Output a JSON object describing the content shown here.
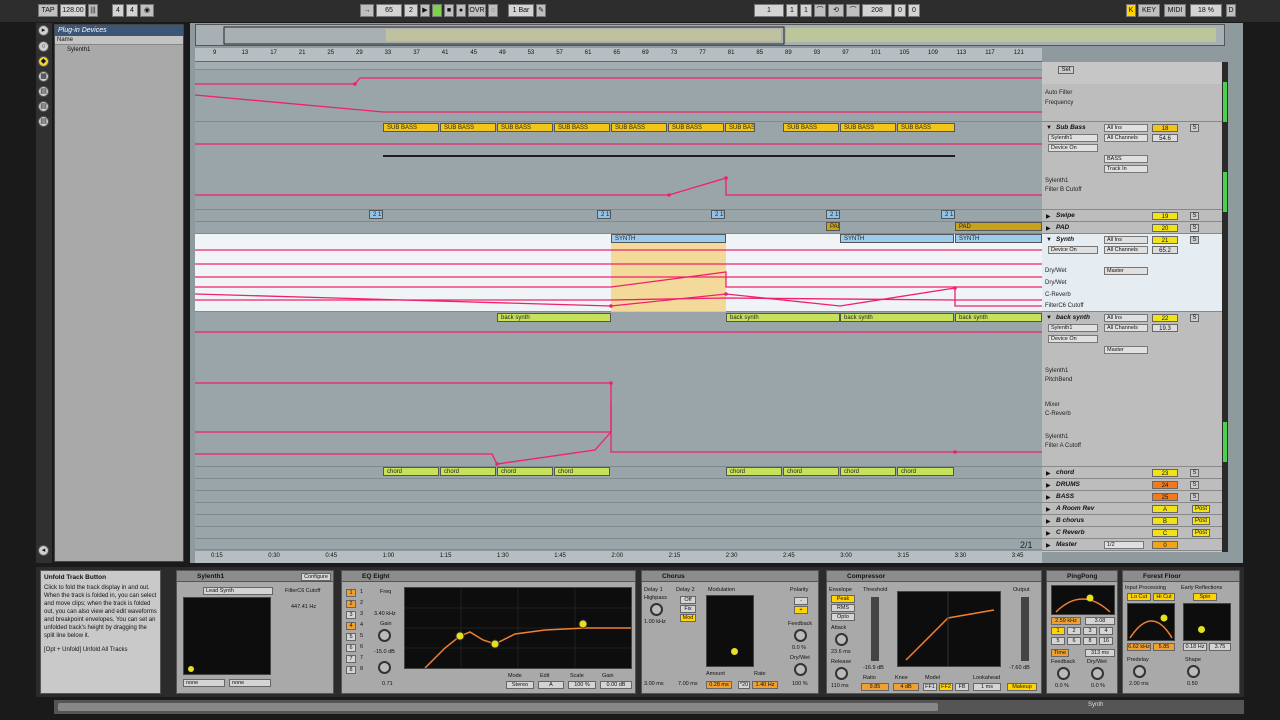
{
  "transport": {
    "tap": "TAP",
    "tempo": "128.00",
    "sig_num": "4",
    "sig_den": "4",
    "bar_pos": "65",
    "beat_pos": "2",
    "ovr": "OVR",
    "quant": "1 Bar",
    "loop_start_bar": "1",
    "loop_start_beat": "1",
    "loop_start_sixteenth": "1",
    "loop_len": "208",
    "loop_len_b": "0",
    "loop_len_s": "0",
    "key": "KEY",
    "midi": "MIDI",
    "cpu": "18 %"
  },
  "browser": {
    "title": "Plug-in Devices",
    "col": "Name",
    "item": "Sylenth1"
  },
  "ruler": [
    "9",
    "13",
    "17",
    "21",
    "25",
    "29",
    "33",
    "37",
    "41",
    "45",
    "49",
    "53",
    "57",
    "61",
    "65",
    "69",
    "73",
    "77",
    "81",
    "85",
    "89",
    "93",
    "97",
    "101",
    "105",
    "109",
    "113",
    "117",
    "121"
  ],
  "times": [
    "0:15",
    "0:30",
    "0:45",
    "1:00",
    "1:15",
    "1:30",
    "1:45",
    "2:00",
    "2:15",
    "2:30",
    "2:45",
    "3:00",
    "3:15",
    "3:30",
    "3:45"
  ],
  "page_indicator": "2/1",
  "clips": {
    "sub_bass": "SUB BASS",
    "sub_bass_cut": "SUB BAS",
    "synth": "SYNTH",
    "pad": "PAD",
    "back_synth": "back synth",
    "chord": "chord",
    "tag": "2 19",
    "tag_cut": "2 1"
  },
  "set_label": "Set",
  "tracks": [
    {
      "name": "Sub Bass",
      "num": "18",
      "in": "All Ins",
      "in2": "Sylenth1",
      "ch": "All Channels",
      "dev": "Device On",
      "out": "BASS",
      "mon": "Track In",
      "plabels": [
        "Sylenth1",
        "Filter B Cutoff"
      ],
      "top_labels": [
        "Auto Filter",
        "Frequency"
      ],
      "vol": "54.6",
      "pan": "C"
    },
    {
      "name": "Swipe",
      "num": "19"
    },
    {
      "name": "PAD",
      "num": "20"
    },
    {
      "name": "Synth",
      "num": "21",
      "in": "All Ins",
      "ch": "All Channels",
      "dev": "Device On",
      "out": "Master",
      "vol": "65.2",
      "pan": "C",
      "plabels": [
        "Dry/Wet",
        "Dry/Wet",
        "C-Reverb",
        "FilterC6 Cutoff"
      ]
    },
    {
      "name": "back synth",
      "num": "22",
      "in": "All Ins",
      "in2": "Sylenth1",
      "ch": "All Channels",
      "dev": "Device On",
      "out": "Master",
      "vol": "19.3",
      "pan": "C",
      "plabels": [
        "Sylenth1",
        "PitchBend",
        "Mixer",
        "C-Reverb",
        "Sylenth1",
        "Filter A Cutoff"
      ]
    },
    {
      "name": "chord",
      "num": "23"
    },
    {
      "name": "DRUMS",
      "num": "24"
    },
    {
      "name": "BASS",
      "num": "25"
    },
    {
      "name": "A Room Rev",
      "num": "A"
    },
    {
      "name": "B chorus",
      "num": "B"
    },
    {
      "name": "C Reverb",
      "num": "C"
    },
    {
      "name": "Master",
      "num": "0",
      "out": "1/2"
    }
  ],
  "mixer_btns": {
    "solo": "S",
    "post": "Post",
    "auto": "Auto",
    "off": "Off",
    "inf": "-inf",
    "in": "In"
  },
  "info": {
    "title": "Unfold Track Button",
    "body": "Click to fold the track display in and out. When the track is folded in, you can select and move clips; when the track is folded out, you can also view and edit waveforms and breakpoint envelopes. You can set an unfolded track's height by dragging the split line below it.",
    "shortcut": "[Opt + Unfold] Unfold All Tracks"
  },
  "devices": {
    "sylenth": {
      "title": "Sylenth1",
      "configure": "Configure",
      "preset": "Lead Synth",
      "param": "FilterC6 Cutoff",
      "value": "447.41 Hz",
      "sel1": "none",
      "sel2": "none"
    },
    "eq": {
      "title": "EQ Eight",
      "freq": "Freq",
      "freq_val": "3.40 kHz",
      "gain": "Gain",
      "gain_val": "-15.0 dB",
      "q_val": "0.71",
      "mode": "Mode",
      "mode_val": "Stereo",
      "edit": "Edit",
      "edit_val": "A",
      "scale": "Scale",
      "scale_val": "100 %",
      "gain_out": "Gain",
      "gain_out_val": "0.00 dB",
      "bands": [
        "1",
        "2",
        "3",
        "4",
        "5",
        "6",
        "7",
        "8"
      ]
    },
    "chorus": {
      "title": "Chorus",
      "d1": "Delay 1",
      "d2": "Delay 2",
      "highpass": "Highpass",
      "hp_val": "1.00 kHz",
      "off": "Off",
      "fix": "Fix",
      "mod_btn": "Mod",
      "d1_time": "3.00 ms",
      "d2_time": "7.00 ms",
      "modulation": "Modulation",
      "amount": "Amount",
      "amount_val": "0.28 ms",
      "rate": "Rate",
      "rate_val": "1.40 Hz",
      "x20": "*20",
      "polarity": "Polarity",
      "feedback": "Feedback",
      "fb_val": "0.0 %",
      "drywet": "Dry/Wet",
      "dw_val": "100 %"
    },
    "compressor": {
      "title": "Compressor",
      "envelope": "Envelope",
      "peak": "Peak",
      "rms": "RMS",
      "opto": "Opto",
      "attack": "Attack",
      "attack_val": "23.6 ms",
      "release": "Release",
      "release_val": "110 ms",
      "threshold": "Threshold",
      "thr_val": "-16.9 dB",
      "ratio": "Ratio",
      "ratio_val": "9.85",
      "knee": "Knee",
      "knee_val": "4 dB",
      "model": "Model",
      "ff1": "FF1",
      "ff2": "FF2",
      "fb": "FB",
      "lookahead": "Lookahead",
      "la_val": "1 ms",
      "output": "Output",
      "out_val": "-7.60 dB",
      "makeup": "Makeup"
    },
    "pingpong": {
      "title": "PingPong",
      "freq": "2.59 kHz",
      "width": "3.08",
      "nums": [
        "1",
        "2",
        "3",
        "4",
        "5",
        "6",
        "8",
        "16"
      ],
      "time": "Time",
      "time_val": "313 ms",
      "feedback": "Feedback",
      "fb_val": "0.0 %",
      "drywet": "Dry/Wet",
      "dw_val": "0.0 %"
    },
    "forest": {
      "title": "Forest Floor",
      "input": "Input Processing",
      "lo_cut": "Lo Cut",
      "hi_cut": "Hi Cut",
      "early": "Early Reflections",
      "spin": "Spin",
      "in_freq": "6.62 kHz",
      "in_q": "5.85",
      "er_freq": "0.18 Hz",
      "er_amt": "3.75",
      "predelay": "Predelay",
      "pd_val": "2.00 ms",
      "shape": "Shape",
      "shape_val": "0.50"
    }
  },
  "footer": {
    "track": "Synth"
  },
  "colors": {
    "envelope": "#f0206a",
    "sub_bass": "#f2c518",
    "synth": "#9ccbeb",
    "back_synth": "#c6e25a",
    "selection": "#f4d58a"
  }
}
